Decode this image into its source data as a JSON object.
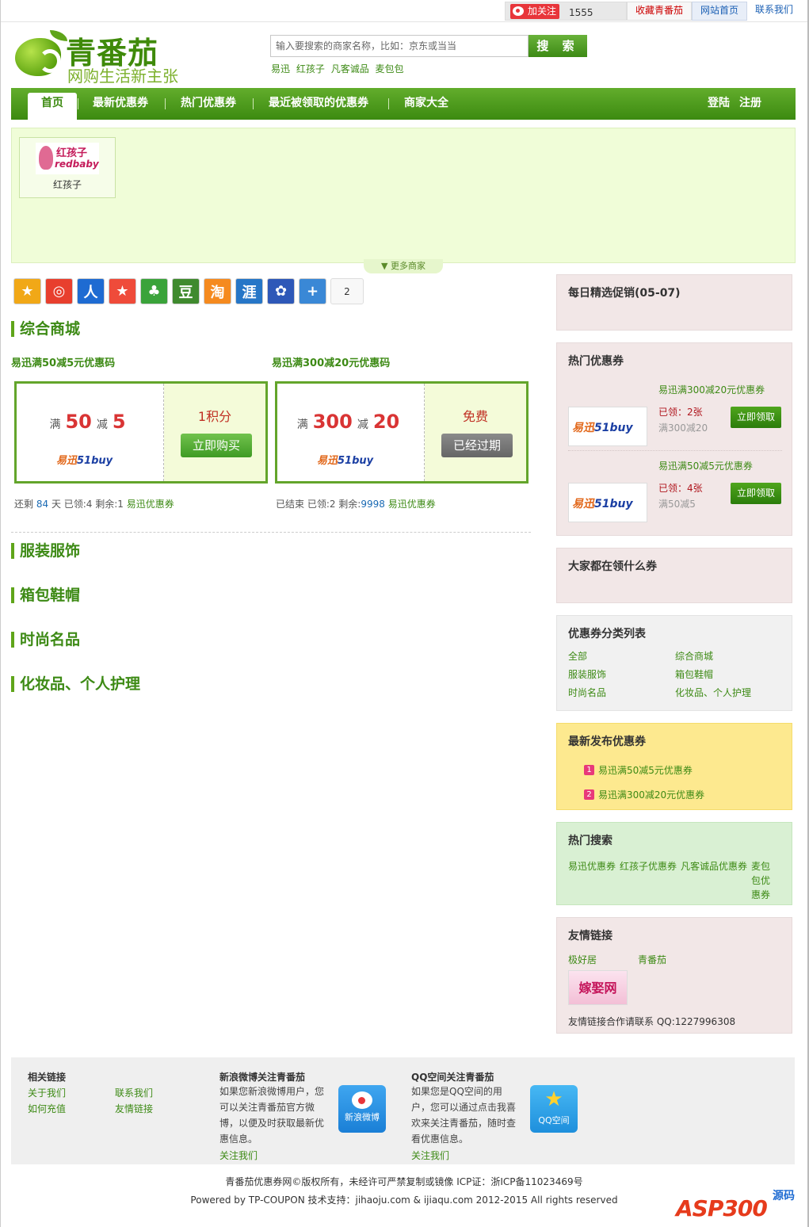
{
  "topbar": {
    "weibo_follow": "加关注",
    "fans_count": "1555",
    "favorite": "收藏青番茄",
    "home": "网站首页",
    "contact": "联系我们"
  },
  "header": {
    "logo_title": "青番茄",
    "logo_slogan": "网购生活新主张",
    "search_placeholder": "输入要搜索的商家名称，比如：京东或当当",
    "search_button": "搜 索",
    "hot_keywords": [
      "易迅",
      "红孩子",
      "凡客诚品",
      "麦包包"
    ]
  },
  "nav": {
    "items": [
      "首页",
      "最新优惠券",
      "热门优惠券",
      "最近被领取的优惠券",
      "商家大全"
    ],
    "login": "登陆",
    "register": "注册"
  },
  "merchants": {
    "items": [
      {
        "name": "红孩子",
        "logo_cn": "红孩子",
        "logo_en": "redbaby"
      }
    ],
    "more": "更多商家"
  },
  "share": {
    "icons": [
      "qzone-icon",
      "weibo-icon",
      "renren-icon",
      "kaixin-icon",
      "clover-icon",
      "douban-icon",
      "taobao-icon",
      "hui-icon",
      "baidu-icon",
      "more-plus-icon"
    ],
    "glyphs": [
      "★",
      "◎",
      "人",
      "★",
      "♣",
      "豆",
      "淘",
      "涯",
      "✿",
      "+"
    ],
    "colors": [
      "#f1a817",
      "#e83f2e",
      "#1e6bd2",
      "#ef4b3a",
      "#3aa33a",
      "#3f8a2e",
      "#f58a1f",
      "#2676c7",
      "#2e58b8",
      "#3a88d6"
    ],
    "count": "2"
  },
  "sections": {
    "zonghe": "综合商城",
    "fuzhuang": "服装服饰",
    "xiangbao": "箱包鞋帽",
    "shishang": "时尚名品",
    "huazhuang": "化妆品、个人护理"
  },
  "coupons": [
    {
      "title": "易迅满50减5元优惠码",
      "man": "满",
      "amount": "50",
      "jian": "减",
      "discount": "5",
      "brand": "易迅",
      "brand_suffix": "51buy",
      "price": "1积分",
      "button": "立即购买",
      "meta_prefix": "还剩",
      "meta_days": "84",
      "meta_mid": "天 已领:4 剩余:1",
      "meta_link": "易迅优惠券"
    },
    {
      "title": "易迅满300减20元优惠码",
      "man": "满",
      "amount": "300",
      "jian": "减",
      "discount": "20",
      "brand": "易迅",
      "brand_suffix": "51buy",
      "price": "免费",
      "button": "已经过期",
      "meta_prefix": "已结束 已领:2 剩余:",
      "meta_days": "9998",
      "meta_mid": "",
      "meta_link": "易迅优惠券"
    }
  ],
  "sidebar": {
    "daily": "每日精选促销(05-07)",
    "hot_coupons": {
      "title": "热门优惠券",
      "items": [
        {
          "title": "易迅满300减20元优惠券",
          "got": "已领：2张",
          "cond": "满300减20",
          "button": "立即领取",
          "brand": "易迅",
          "brand_suffix": "51buy"
        },
        {
          "title": "易迅满50减5元优惠券",
          "got": "已领：4张",
          "cond": "满50减5",
          "button": "立即领取",
          "brand": "易迅",
          "brand_suffix": "51buy"
        }
      ]
    },
    "everyone": "大家都在领什么券",
    "categories": {
      "title": "优惠券分类列表",
      "items": [
        "全部",
        "综合商城",
        "服装服饰",
        "箱包鞋帽",
        "时尚名品",
        "化妆品、个人护理"
      ]
    },
    "latest": {
      "title": "最新发布优惠券",
      "items": [
        {
          "n": "1",
          "text": "易迅满50减5元优惠券"
        },
        {
          "n": "2",
          "text": "易迅满300减20元优惠券"
        }
      ]
    },
    "hot_search": {
      "title": "热门搜索",
      "items": [
        "易迅优惠券",
        "红孩子优惠券",
        "凡客诚品优惠券",
        "麦包",
        "包优",
        "惠券"
      ]
    },
    "friend_links": {
      "title": "友情链接",
      "items": [
        "极好居",
        "青番茄"
      ],
      "banner": "嫁娶网",
      "contact": "友情链接合作请联系  QQ:1227996308"
    }
  },
  "footer": {
    "related": {
      "title": "相关链接",
      "links": [
        "关于我们",
        "联系我们",
        "如何充值",
        "友情链接"
      ]
    },
    "weibo": {
      "title": "新浪微博关注青番茄",
      "lines": [
        "如果您新浪微博用户，您",
        "可以关注青番茄官方微",
        "博，以便及时获取最新优",
        "惠信息。"
      ],
      "follow": "关注我们",
      "icon_label": "新浪微博"
    },
    "qzone": {
      "title": "QQ空间关注青番茄",
      "lines": [
        "如果您是QQ空间的用",
        "户，您可以通过点击我喜",
        "欢来关注青番茄，随时查",
        "看优惠信息。"
      ],
      "follow": "关注我们",
      "icon_label": "QQ空间"
    },
    "copyright": "青番茄优惠券网©版权所有，未经许可严禁复制或镜像  ICP证：浙ICP备11023469号",
    "powered": "Powered by TP-COUPON 技术支持：jihaoju.com & ijiaqu.com 2012-2015 All rights reserved",
    "watermark_main": "ASP300",
    "watermark_side": "源码"
  }
}
